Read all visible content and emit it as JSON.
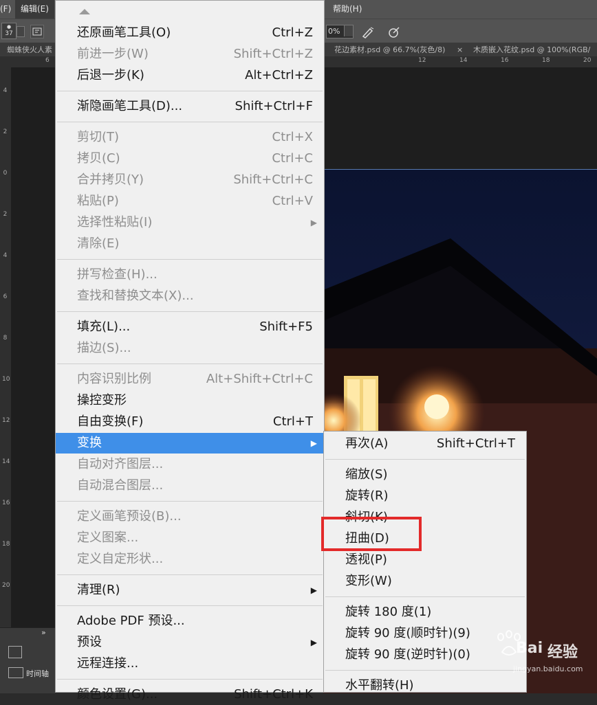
{
  "menubar": {
    "file_fragment": "(F)",
    "edit": "编辑(E)",
    "help": "帮助(H)"
  },
  "options": {
    "brush_size": "37",
    "percent": "0%"
  },
  "tabs": [
    {
      "label": "蜘蛛侠火人素"
    },
    {
      "label": "花边素材.psd @ 66.7%(灰色/8)"
    },
    {
      "label": "木质嵌入花纹.psd @ 100%(RGB/"
    }
  ],
  "tab_close": "×",
  "ruler": {
    "h_ticks": [
      "6",
      "12",
      "14",
      "16",
      "18",
      "20"
    ],
    "v_ticks": [
      "4",
      "2",
      "0",
      "2",
      "4",
      "6",
      "8",
      "10",
      "12",
      "14",
      "16",
      "18",
      "20"
    ]
  },
  "panel": {
    "timeline": "时间轴"
  },
  "edit_menu": {
    "groups": [
      [
        {
          "label": "还原画笔工具(O)",
          "shortcut": "Ctrl+Z",
          "enabled": true
        },
        {
          "label": "前进一步(W)",
          "shortcut": "Shift+Ctrl+Z",
          "enabled": false
        },
        {
          "label": "后退一步(K)",
          "shortcut": "Alt+Ctrl+Z",
          "enabled": true
        }
      ],
      [
        {
          "label": "渐隐画笔工具(D)...",
          "shortcut": "Shift+Ctrl+F",
          "enabled": true
        }
      ],
      [
        {
          "label": "剪切(T)",
          "shortcut": "Ctrl+X",
          "enabled": false
        },
        {
          "label": "拷贝(C)",
          "shortcut": "Ctrl+C",
          "enabled": false
        },
        {
          "label": "合并拷贝(Y)",
          "shortcut": "Shift+Ctrl+C",
          "enabled": false
        },
        {
          "label": "粘贴(P)",
          "shortcut": "Ctrl+V",
          "enabled": false
        },
        {
          "label": "选择性粘贴(I)",
          "shortcut": "",
          "enabled": false,
          "submenu": true
        },
        {
          "label": "清除(E)",
          "shortcut": "",
          "enabled": false
        }
      ],
      [
        {
          "label": "拼写检查(H)...",
          "shortcut": "",
          "enabled": false
        },
        {
          "label": "查找和替换文本(X)...",
          "shortcut": "",
          "enabled": false
        }
      ],
      [
        {
          "label": "填充(L)...",
          "shortcut": "Shift+F5",
          "enabled": true
        },
        {
          "label": "描边(S)...",
          "shortcut": "",
          "enabled": false
        }
      ],
      [
        {
          "label": "内容识别比例",
          "shortcut": "Alt+Shift+Ctrl+C",
          "enabled": false
        },
        {
          "label": "操控变形",
          "shortcut": "",
          "enabled": true
        },
        {
          "label": "自由变换(F)",
          "shortcut": "Ctrl+T",
          "enabled": true
        },
        {
          "label": "变换",
          "shortcut": "",
          "enabled": true,
          "submenu": true,
          "highlighted": true
        },
        {
          "label": "自动对齐图层...",
          "shortcut": "",
          "enabled": false
        },
        {
          "label": "自动混合图层...",
          "shortcut": "",
          "enabled": false
        }
      ],
      [
        {
          "label": "定义画笔预设(B)...",
          "shortcut": "",
          "enabled": false
        },
        {
          "label": "定义图案...",
          "shortcut": "",
          "enabled": false
        },
        {
          "label": "定义自定形状...",
          "shortcut": "",
          "enabled": false
        }
      ],
      [
        {
          "label": "清理(R)",
          "shortcut": "",
          "enabled": true,
          "submenu": true
        }
      ],
      [
        {
          "label": "Adobe PDF 预设...",
          "shortcut": "",
          "enabled": true
        },
        {
          "label": "预设",
          "shortcut": "",
          "enabled": true,
          "submenu": true
        },
        {
          "label": "远程连接...",
          "shortcut": "",
          "enabled": true
        }
      ],
      [
        {
          "label": "颜色设置(G)...",
          "shortcut": "Shift+Ctrl+K",
          "enabled": true
        }
      ]
    ]
  },
  "transform_submenu": {
    "groups": [
      [
        {
          "label": "再次(A)",
          "shortcut": "Shift+Ctrl+T"
        }
      ],
      [
        {
          "label": "缩放(S)",
          "shortcut": ""
        },
        {
          "label": "旋转(R)",
          "shortcut": ""
        },
        {
          "label": "斜切(K)",
          "shortcut": ""
        },
        {
          "label": "扭曲(D)",
          "shortcut": "",
          "marked": true
        },
        {
          "label": "透视(P)",
          "shortcut": ""
        },
        {
          "label": "变形(W)",
          "shortcut": ""
        }
      ],
      [
        {
          "label": "旋转 180 度(1)",
          "shortcut": ""
        },
        {
          "label": "旋转 90 度(顺时针)(9)",
          "shortcut": ""
        },
        {
          "label": "旋转 90 度(逆时针)(0)",
          "shortcut": ""
        }
      ],
      [
        {
          "label": "水平翻转(H)",
          "shortcut": ""
        }
      ]
    ]
  },
  "watermark": {
    "brand": "Bai",
    "brand_tail": "经验",
    "url": "jingyan.baidu.com"
  },
  "colors": {
    "highlight": "#3f8fe8",
    "annotation": "#e32a2a"
  }
}
